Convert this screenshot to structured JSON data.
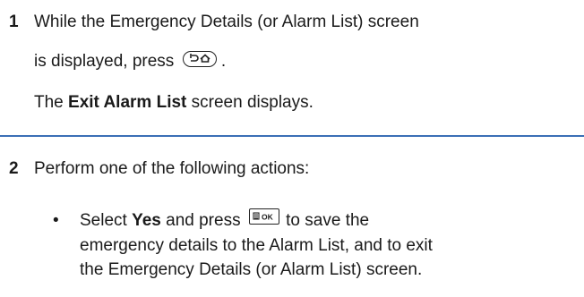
{
  "step1": {
    "number": "1",
    "line1": "While the Emergency Details (or Alarm List) screen",
    "line2_pre": "is displayed, press",
    "line2_post": ".",
    "home_key_icon": "back-home-key-icon",
    "result_pre": "The ",
    "result_bold": "Exit Alarm List",
    "result_post": " screen displays."
  },
  "divider_color": "#3b6fb6",
  "step2": {
    "number": "2",
    "intro": "Perform one of the following actions:",
    "bullet_symbol": "•",
    "bullet1": {
      "pre": "Select ",
      "bold": "Yes",
      "mid": " and press",
      "ok_key_icon": "menu-ok-key-icon",
      "post": " to save the",
      "line2": "emergency details to the Alarm List, and to exit",
      "line3": "the Emergency Details (or Alarm List) screen."
    }
  }
}
